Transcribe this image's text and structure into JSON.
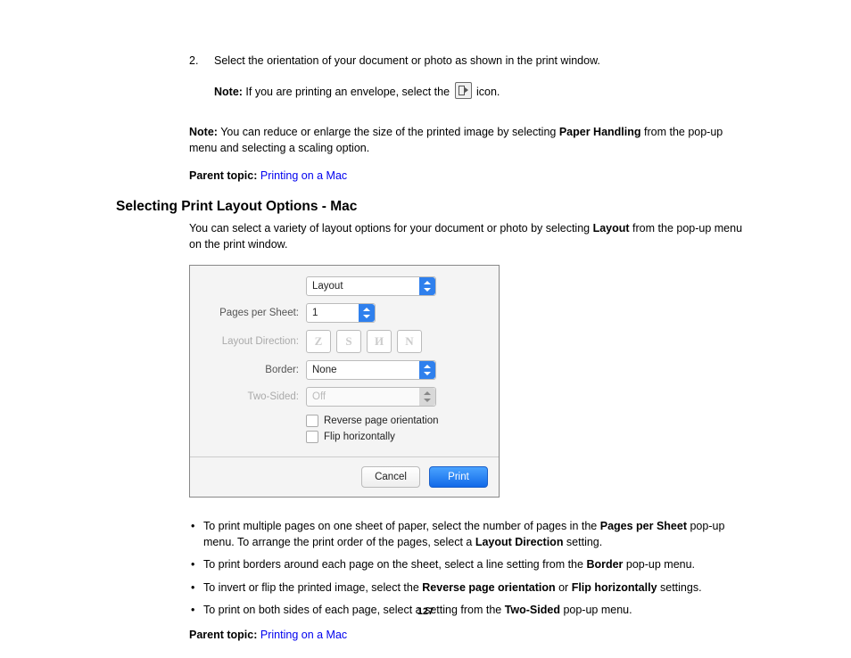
{
  "step": {
    "num": "2.",
    "text": "Select the orientation of your document or photo as shown in the print window.",
    "note_label": "Note:",
    "note_text_pre": " If you are printing an envelope, select the ",
    "note_text_post": " icon."
  },
  "note2": {
    "label": "Note:",
    "text_pre": " You can reduce or enlarge the size of the printed image by selecting ",
    "bold": "Paper Handling",
    "text_post": " from the pop-up menu and selecting a scaling option."
  },
  "parent_label": "Parent topic:",
  "parent_link": "Printing on a Mac",
  "heading": "Selecting Print Layout Options - Mac",
  "intro_pre": "You can select a variety of layout options for your document or photo by selecting ",
  "intro_bold": "Layout",
  "intro_post": " from the pop-up menu on the print window.",
  "dlg": {
    "section": "Layout",
    "pps_label": "Pages per Sheet:",
    "pps_value": "1",
    "ld_label": "Layout Direction:",
    "ld_glyphs": [
      "Z",
      "S",
      "И",
      "N"
    ],
    "border_label": "Border:",
    "border_value": "None",
    "two_label": "Two-Sided:",
    "two_value": "Off",
    "reverse": "Reverse page orientation",
    "flip": "Flip horizontally",
    "cancel": "Cancel",
    "print": "Print"
  },
  "bullets": {
    "b1_pre": "To print multiple pages on one sheet of paper, select the number of pages in the ",
    "b1_b1": "Pages per Sheet",
    "b1_mid": " pop-up menu. To arrange the print order of the pages, select a ",
    "b1_b2": "Layout Direction",
    "b1_post": " setting.",
    "b2_pre": "To print borders around each page on the sheet, select a line setting from the ",
    "b2_b1": "Border",
    "b2_post": " pop-up menu.",
    "b3_pre": "To invert or flip the printed image, select the ",
    "b3_b1": "Reverse page orientation",
    "b3_mid": " or ",
    "b3_b2": "Flip horizontally",
    "b3_post": " settings.",
    "b4_pre": "To print on both sides of each page, select a setting from the ",
    "b4_b1": "Two-Sided",
    "b4_post": " pop-up menu."
  },
  "page_num": "127"
}
